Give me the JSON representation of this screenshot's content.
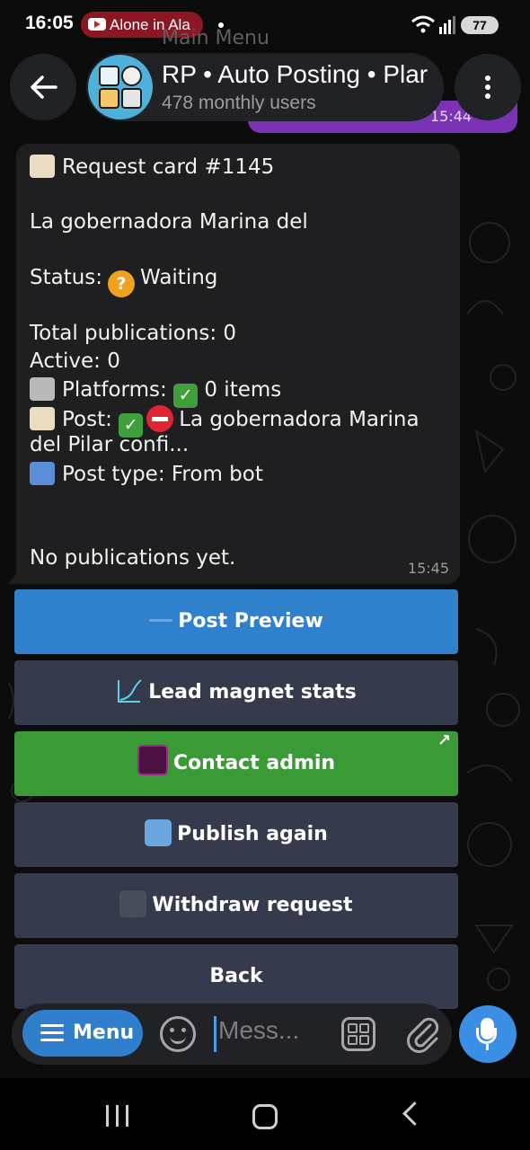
{
  "status_bar": {
    "time": "16:05",
    "media_text": "Alone in Ala",
    "battery": "77"
  },
  "header": {
    "background_row_text": "Main Menu",
    "background_bubble_time": "15:44",
    "title": "RP • Auto Posting • Plar",
    "subtitle": "478 monthly users"
  },
  "message": {
    "line1": "Request card #1145",
    "line2": "La gobernadora Marina del",
    "status_label": "Status:",
    "status_value": "Waiting",
    "total_publications": "Total publications: 0",
    "active": "Active: 0",
    "platforms_label": "Platforms:",
    "platforms_value": "0 items",
    "post_label": "Post:",
    "post_value": "La gobernadora Marina",
    "post_value_cont": "del Pilar confi...",
    "post_type": "Post type: From bot",
    "no_publications": "No publications yet.",
    "time": "15:45"
  },
  "keyboard": {
    "post_preview": "Post Preview",
    "lead_magnet_stats": "Lead magnet stats",
    "contact_admin": "Contact admin",
    "publish_again": "Publish again",
    "withdraw_request": "Withdraw request",
    "back": "Back"
  },
  "input_bar": {
    "menu_label": "Menu",
    "placeholder": "Mess..."
  },
  "colors": {
    "accent_blue": "#2f80cd",
    "accent_green": "#3a9a35",
    "button_gray": "#353a4c",
    "bubble": "#1f1f21",
    "purple_bubble": "#7b33b5"
  }
}
